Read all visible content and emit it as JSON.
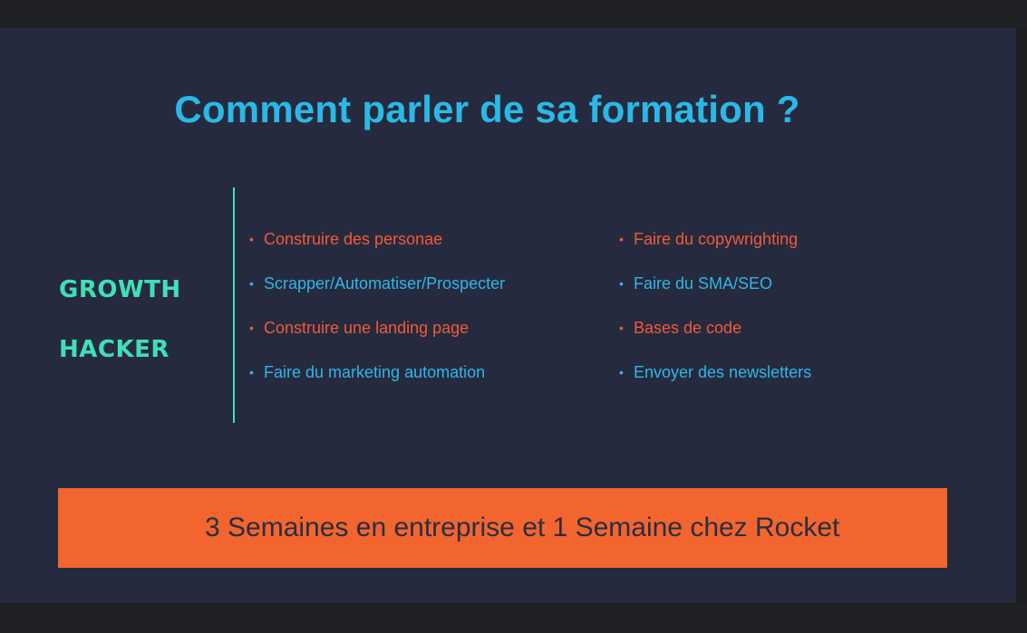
{
  "slide": {
    "title": "Comment parler de sa formation ?",
    "role_line_1": "GROWTH",
    "role_line_2": "HACKER",
    "banner": "3 Semaines en entreprise et 1 Semaine chez Rocket",
    "columns": [
      [
        {
          "text": "Construire des personae",
          "color": "#ef5a3a"
        },
        {
          "text": "Scrapper/Automatiser/Prospecter",
          "color": "#2fb6e8"
        },
        {
          "text": "Construire une landing page",
          "color": "#ef5a3a"
        },
        {
          "text": "Faire du marketing automation",
          "color": "#2fb6e8"
        }
      ],
      [
        {
          "text": "Faire du copywrighting",
          "color": "#ef5a3a"
        },
        {
          "text": "Faire du SMA/SEO",
          "color": "#2fb6e8"
        },
        {
          "text": "Bases de code",
          "color": "#ef5a3a"
        },
        {
          "text": "Envoyer des newsletters",
          "color": "#2fb6e8"
        }
      ]
    ],
    "colors": {
      "background": "#262a3e",
      "title": "#29b9e6",
      "role": "#3fe0b8",
      "banner_bg": "#f2652e",
      "banner_text": "#2b2d40"
    }
  }
}
